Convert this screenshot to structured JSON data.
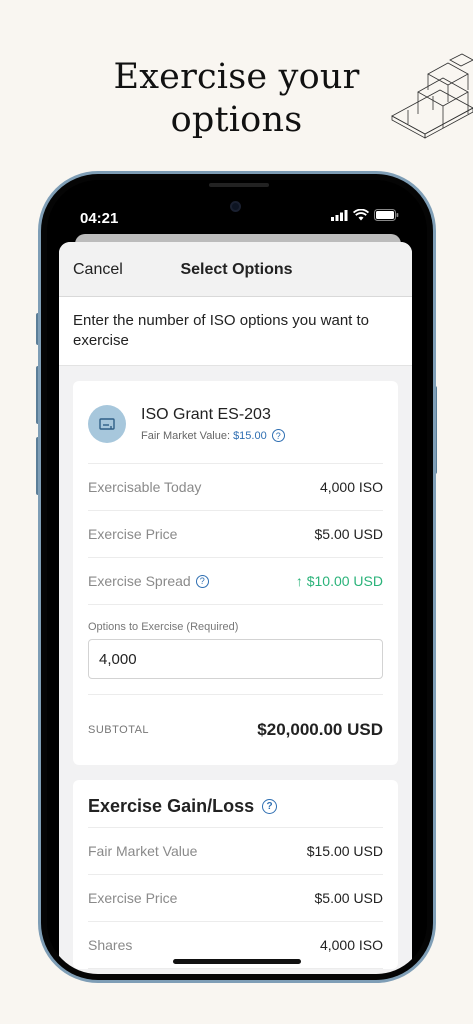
{
  "headline": {
    "line1": "Exercise your",
    "line2": "options"
  },
  "status": {
    "time": "04:21"
  },
  "nav": {
    "cancel_label": "Cancel",
    "title": "Select Options"
  },
  "instruction": "Enter the number of ISO options you want to exercise",
  "grant": {
    "icon": "certificate-icon",
    "title": "ISO Grant ES-203",
    "fmv_label": "Fair Market Value:",
    "fmv_value": "$15.00"
  },
  "details": [
    {
      "label": "Exercisable Today",
      "value": "4,000 ISO"
    },
    {
      "label": "Exercise Price",
      "value": "$5.00 USD"
    },
    {
      "label": "Exercise Spread",
      "value": "$10.00 USD"
    }
  ],
  "options_field": {
    "label": "Options to Exercise (Required)",
    "value": "4,000"
  },
  "subtotal": {
    "label": "SUBTOTAL",
    "value": "$20,000.00 USD"
  },
  "gain_loss": {
    "title": "Exercise Gain/Loss",
    "rows": [
      {
        "label": "Fair Market Value",
        "value": "$15.00 USD"
      },
      {
        "label": "Exercise Price",
        "value": "$5.00 USD"
      },
      {
        "label": "Shares",
        "value": "4,000 ISO"
      }
    ]
  },
  "colors": {
    "accent_blue": "#2f6fb2",
    "positive_green": "#2bb37a",
    "phone_frame": "#7f9eb6",
    "background": "#f9f6f1"
  }
}
